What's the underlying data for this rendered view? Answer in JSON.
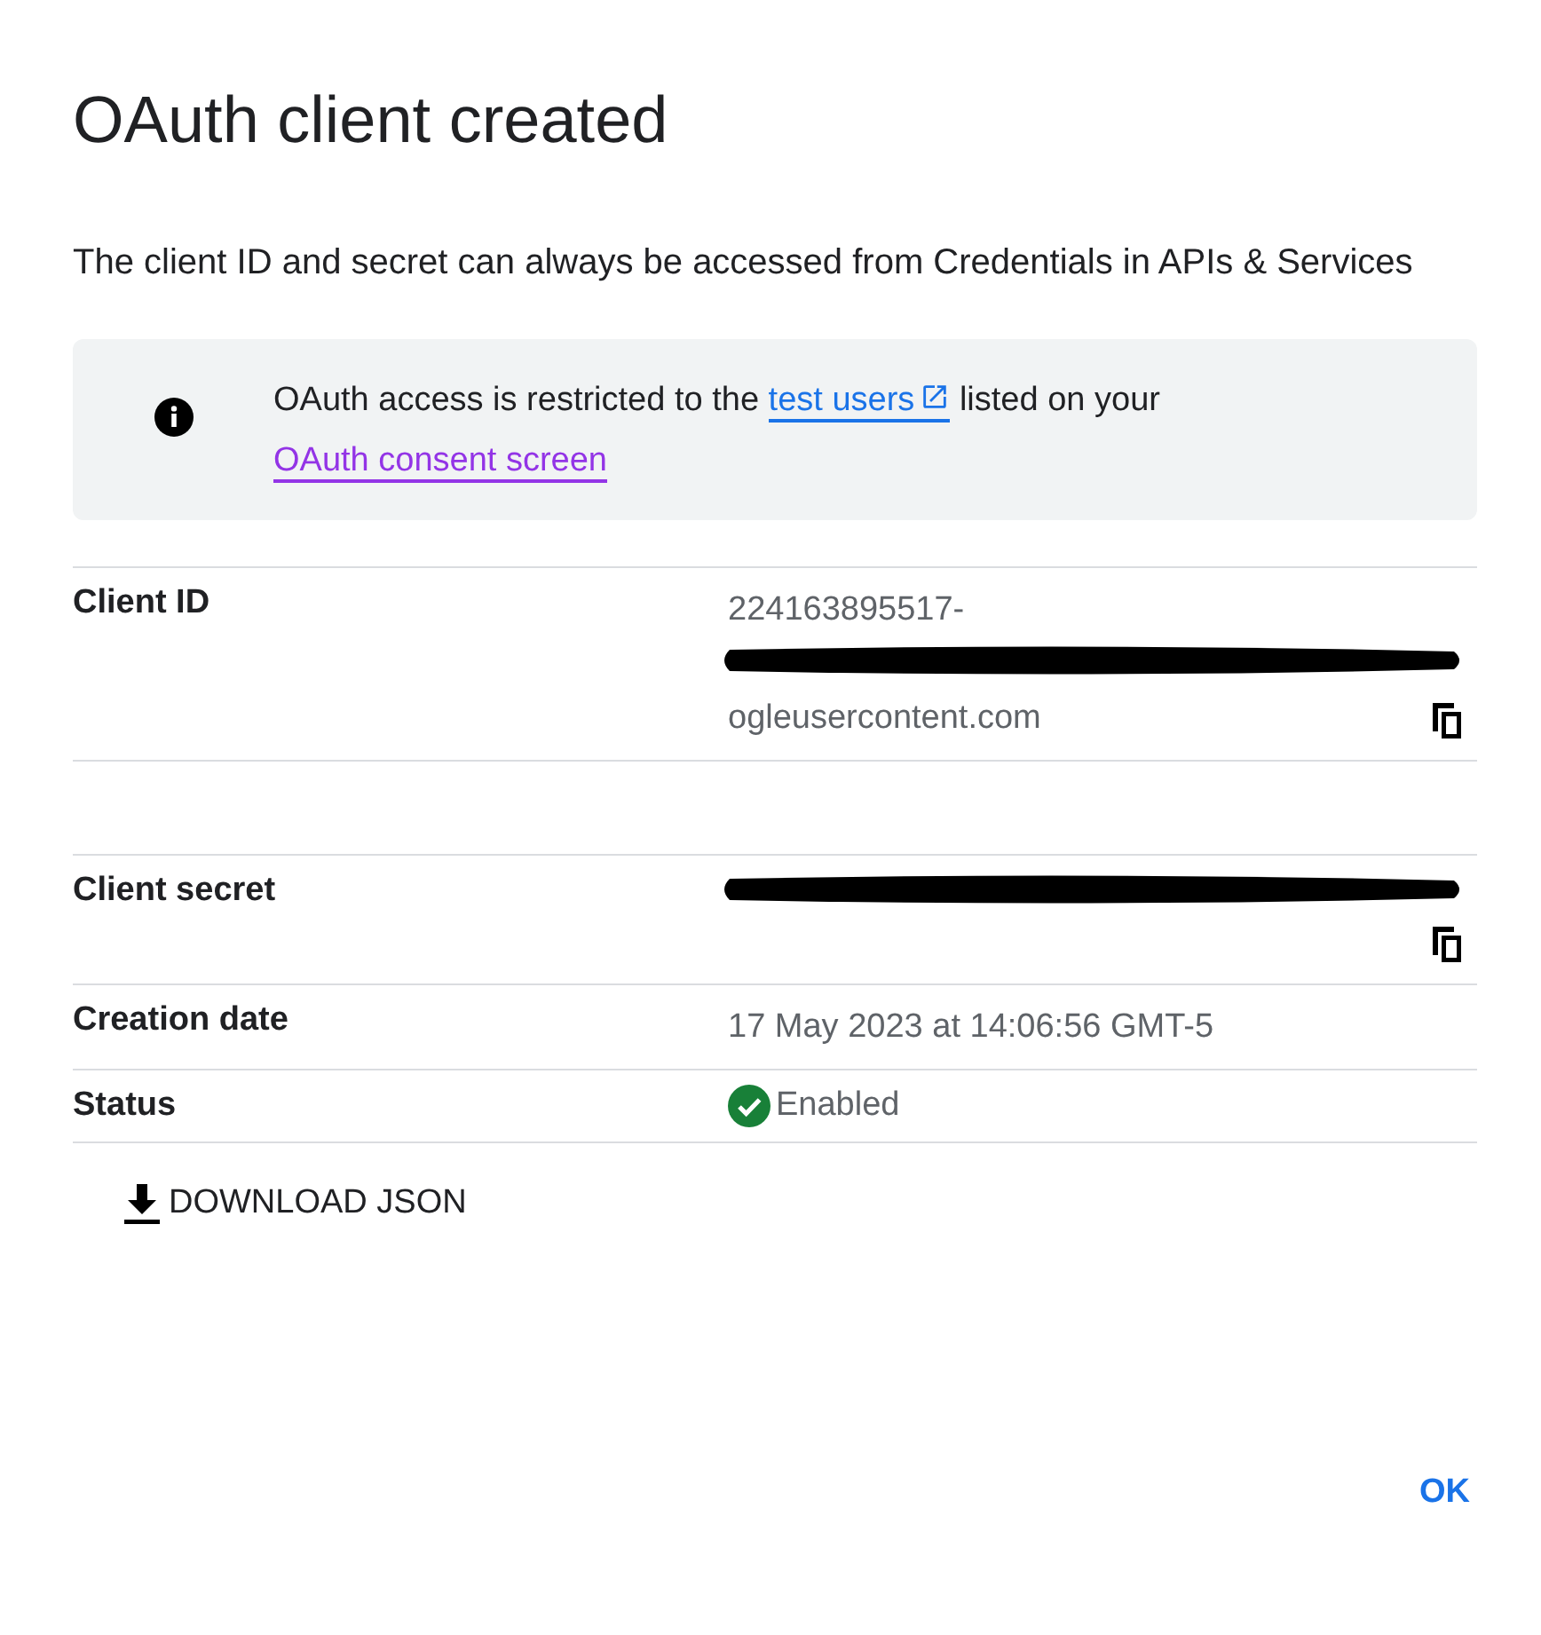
{
  "dialog": {
    "title": "OAuth client created",
    "description": "The client ID and secret can always be accessed from Credentials in APIs & Services",
    "notice": {
      "kind": "info",
      "parts": [
        {
          "kind": "text",
          "text": "OAuth access is restricted to the "
        },
        {
          "kind": "link",
          "text": "test users",
          "external": true,
          "visited": false
        },
        {
          "kind": "text",
          "text": " listed on your "
        },
        {
          "kind": "link",
          "text": "OAuth consent screen",
          "external": false,
          "visited": true
        }
      ]
    },
    "details": [
      {
        "kind": "value",
        "label": "Client ID",
        "copyable": true,
        "lines": [
          {
            "kind": "text",
            "text": "224163895517-"
          },
          {
            "kind": "redacted"
          },
          {
            "kind": "text",
            "text": "ogleusercontent.com"
          }
        ]
      },
      {
        "kind": "spacer"
      },
      {
        "kind": "value",
        "label": "Client secret",
        "copyable": true,
        "lines": [
          {
            "kind": "redacted"
          }
        ]
      },
      {
        "kind": "value",
        "label": "Creation date",
        "copyable": false,
        "lines": [
          {
            "kind": "text",
            "text": "17 May 2023 at 14:06:56 GMT-5"
          }
        ]
      },
      {
        "kind": "status",
        "label": "Status",
        "enabled": true,
        "value": "Enabled"
      }
    ],
    "download_button": "DOWNLOAD JSON",
    "ok_button": "OK"
  }
}
